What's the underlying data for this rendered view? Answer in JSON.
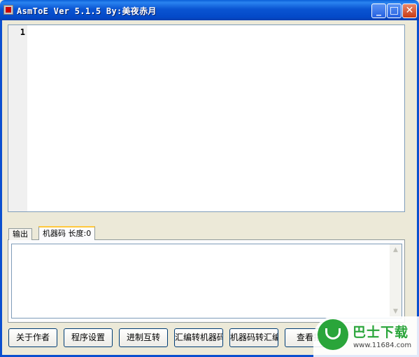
{
  "window": {
    "title": "AsmToE Ver 5.1.5  By:美夜赤月",
    "minimize_glyph": "_",
    "maximize_glyph": "□",
    "close_glyph": "✕"
  },
  "editor": {
    "line_numbers": [
      "1"
    ]
  },
  "tabs": [
    {
      "label": "输出",
      "active": false
    },
    {
      "label": "机器码 长度:0",
      "active": true
    }
  ],
  "scrollbar": {
    "up_glyph": "▲",
    "down_glyph": "▼"
  },
  "buttons": [
    {
      "label": "关于作者"
    },
    {
      "label": "程序设置"
    },
    {
      "label": "进制互转"
    },
    {
      "label": "汇编转机器码"
    },
    {
      "label": "机器码转汇编"
    },
    {
      "label": "查看指"
    }
  ],
  "watermark": {
    "text": "巴士下载",
    "url": "www.11684.com"
  },
  "colors": {
    "titlebar": "#0a55d2",
    "window_face": "#ece9d8",
    "active_tab_accent": "#ffc83c",
    "watermark_green": "#2aa53a"
  }
}
